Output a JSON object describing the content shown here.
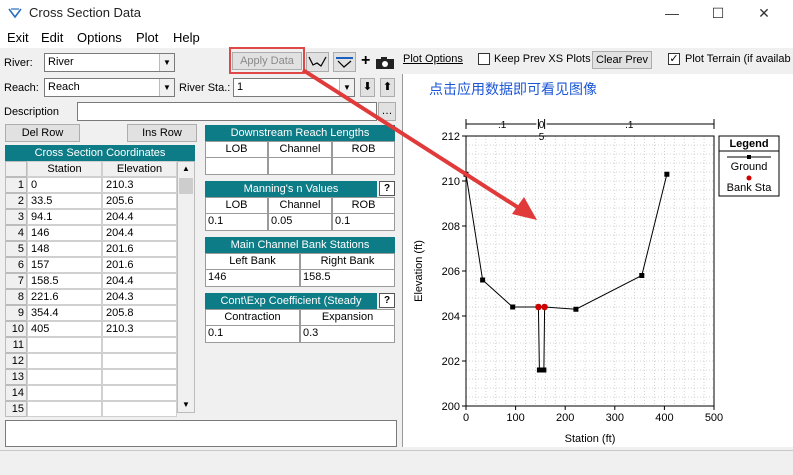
{
  "window": {
    "title": "Cross Section Data",
    "min": "—",
    "max": "☐",
    "close": "✕"
  },
  "menu": [
    "Exit",
    "Edit",
    "Options",
    "Plot",
    "Help"
  ],
  "toolbar": {
    "river_label": "River:",
    "river_value": "River",
    "reach_label": "Reach:",
    "reach_value": "Reach",
    "station_label": "River Sta.:",
    "station_value": "1",
    "description_label": "Description",
    "apply_data": "Apply Data",
    "del_row": "Del Row",
    "ins_row": "Ins Row"
  },
  "plot_options": {
    "plot_options_link": "Plot Options",
    "keep_prev_label": "Keep Prev XS Plots",
    "keep_prev_checked": false,
    "clear_prev": "Clear Prev",
    "plot_terrain_label": "Plot Terrain (if availab",
    "plot_terrain_checked": true
  },
  "annotation": {
    "text": "点击应用数据即可看见图像",
    "color": "#1a56d6",
    "arrow_color": "#e03a3a"
  },
  "coord_table": {
    "title": "Cross Section Coordinates",
    "col_station": "Station",
    "col_elevation": "Elevation",
    "rows": [
      {
        "n": "1",
        "station": "0",
        "elevation": "210.3"
      },
      {
        "n": "2",
        "station": "33.5",
        "elevation": "205.6"
      },
      {
        "n": "3",
        "station": "94.1",
        "elevation": "204.4"
      },
      {
        "n": "4",
        "station": "146",
        "elevation": "204.4"
      },
      {
        "n": "5",
        "station": "148",
        "elevation": "201.6"
      },
      {
        "n": "6",
        "station": "157",
        "elevation": "201.6"
      },
      {
        "n": "7",
        "station": "158.5",
        "elevation": "204.4"
      },
      {
        "n": "8",
        "station": "221.6",
        "elevation": "204.3"
      },
      {
        "n": "9",
        "station": "354.4",
        "elevation": "205.8"
      },
      {
        "n": "10",
        "station": "405",
        "elevation": "210.3"
      },
      {
        "n": "11",
        "station": "",
        "elevation": ""
      },
      {
        "n": "12",
        "station": "",
        "elevation": ""
      },
      {
        "n": "13",
        "station": "",
        "elevation": ""
      },
      {
        "n": "14",
        "station": "",
        "elevation": ""
      },
      {
        "n": "15",
        "station": "",
        "elevation": ""
      }
    ]
  },
  "reach_lengths": {
    "title": "Downstream Reach Lengths",
    "h1": "LOB",
    "h2": "Channel",
    "h3": "ROB",
    "v1": "",
    "v2": "",
    "v3": ""
  },
  "mannings": {
    "title": "Manning's n Values",
    "h1": "LOB",
    "h2": "Channel",
    "h3": "ROB",
    "v1": "0.1",
    "v2": "0.05",
    "v3": "0.1"
  },
  "bank_stations": {
    "title": "Main Channel Bank Stations",
    "h1": "Left Bank",
    "h2": "Right Bank",
    "v1": "146",
    "v2": "158.5"
  },
  "contraction": {
    "title": "Cont\\Exp Coefficient (Steady",
    "h1": "Contraction",
    "h2": "Expansion",
    "v1": "0.1",
    "v2": "0.3"
  },
  "chart_data": {
    "type": "line",
    "title": "1",
    "xlabel": "Station (ft)",
    "ylabel": "Elevation (ft)",
    "xlim": [
      0,
      500
    ],
    "ylim": [
      200,
      212
    ],
    "xticks": [
      0,
      100,
      200,
      300,
      400,
      500
    ],
    "yticks": [
      200,
      202,
      204,
      206,
      208,
      210,
      212
    ],
    "grid": true,
    "legend_position": "top-right",
    "legend_title": "Legend",
    "reach_length_labels": [
      ".1",
      "0",
      ".1"
    ],
    "reach_length_sub": "5",
    "series": [
      {
        "name": "Ground",
        "color": "#000000",
        "x": [
          0,
          33.5,
          94.1,
          146,
          148,
          157,
          158.5,
          221.6,
          354.4,
          405
        ],
        "y": [
          210.3,
          205.6,
          204.4,
          204.4,
          201.6,
          201.6,
          204.4,
          204.3,
          205.8,
          210.3
        ]
      },
      {
        "name": "Bank Sta",
        "color": "#d00000",
        "x": [
          146,
          158.5
        ],
        "y": [
          204.4,
          204.4
        ]
      }
    ]
  }
}
